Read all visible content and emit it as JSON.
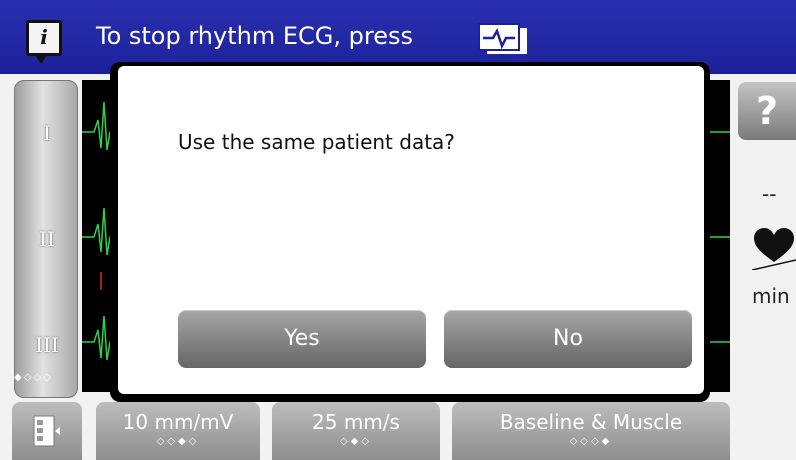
{
  "header": {
    "text": "To stop rhythm ECG, press",
    "info_icon": "i",
    "key_icon": "ecg-key-icon"
  },
  "leads": {
    "items": [
      "I",
      "II",
      "III"
    ],
    "page_dots": "◆◇◇◇"
  },
  "right": {
    "help_label": "?",
    "hr_value": "--",
    "hr_unit": "min"
  },
  "dialog": {
    "message": "Use the same patient data?",
    "yes_label": "Yes",
    "no_label": "No"
  },
  "bottom": {
    "gain": {
      "label": "10 mm/mV",
      "dots": "◇◇◆◇"
    },
    "speed": {
      "label": "25 mm/s",
      "dots": "◇◆◇"
    },
    "filter": {
      "label": "Baseline & Muscle",
      "dots": "◇◇◇◆"
    }
  },
  "colors": {
    "header": "#1c219a",
    "ecg_trace": "#2bd34a",
    "ecg_marker": "#d92b2b"
  }
}
